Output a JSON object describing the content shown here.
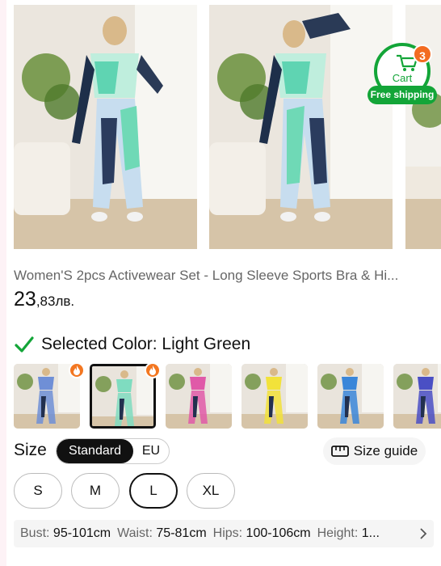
{
  "cart": {
    "label": "Cart",
    "count": "3",
    "shipping_label": "Free shipping"
  },
  "product": {
    "title": "Women'S 2pcs Activewear Set - Long Sleeve Sports Bra & Hi...",
    "price_main": "23",
    "price_rest": ",83лв."
  },
  "color": {
    "selected_label": "Selected Color: Light Green",
    "swatches": [
      {
        "name": "blue-white",
        "accent": "#6f8fd6",
        "hot": true
      },
      {
        "name": "light-green",
        "accent": "#7fdcc0",
        "hot": true,
        "selected": true
      },
      {
        "name": "pink",
        "accent": "#e05aa8",
        "hot": false
      },
      {
        "name": "yellow",
        "accent": "#f2e23a",
        "hot": false
      },
      {
        "name": "blue",
        "accent": "#3a86d9",
        "hot": false
      },
      {
        "name": "navy-purple",
        "accent": "#4a4fc4",
        "hot": false
      }
    ]
  },
  "size": {
    "label": "Size",
    "standard_label": "Standard",
    "eu_label": "EU",
    "guide_label": "Size guide",
    "options": [
      "S",
      "M",
      "L",
      "XL"
    ],
    "selected": "L"
  },
  "measurements": {
    "bust_label": "Bust:",
    "bust_value": "95-101cm",
    "waist_label": "Waist:",
    "waist_value": "75-81cm",
    "hips_label": "Hips:",
    "hips_value": "100-106cm",
    "height_label": "Height:",
    "height_value": "1..."
  },
  "colors": {
    "brand_green": "#13a538",
    "badge_orange": "#f36c21"
  }
}
